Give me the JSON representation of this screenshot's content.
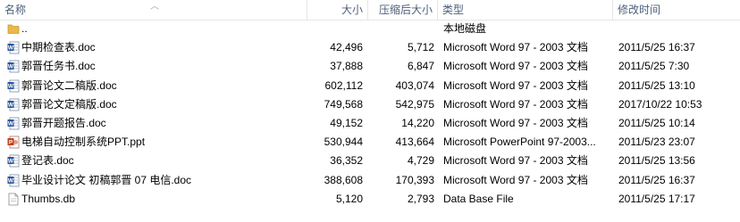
{
  "columns": {
    "name": "名称",
    "size": "大小",
    "compressed": "压缩后大小",
    "type": "类型",
    "modified": "修改时间"
  },
  "files": [
    {
      "name": "..",
      "size": "",
      "compressed": "",
      "type": "本地磁盘",
      "modified": "",
      "icon": "folder-icon"
    },
    {
      "name": "中期检查表.doc",
      "size": "42,496",
      "compressed": "5,712",
      "type": "Microsoft Word 97 - 2003 文档",
      "modified": "2011/5/25 16:37",
      "icon": "word-doc-icon"
    },
    {
      "name": "郭晋任务书.doc",
      "size": "37,888",
      "compressed": "6,847",
      "type": "Microsoft Word 97 - 2003 文档",
      "modified": "2011/5/25 7:30",
      "icon": "word-doc-icon"
    },
    {
      "name": "郭晋论文二稿版.doc",
      "size": "602,112",
      "compressed": "403,074",
      "type": "Microsoft Word 97 - 2003 文档",
      "modified": "2011/5/25 13:10",
      "icon": "word-doc-icon"
    },
    {
      "name": "郭晋论文定稿版.doc",
      "size": "749,568",
      "compressed": "542,975",
      "type": "Microsoft Word 97 - 2003 文档",
      "modified": "2017/10/22 10:53",
      "icon": "word-doc-icon"
    },
    {
      "name": "郭晋开题报告.doc",
      "size": "49,152",
      "compressed": "14,220",
      "type": "Microsoft Word 97 - 2003 文档",
      "modified": "2011/5/25 10:14",
      "icon": "word-doc-icon"
    },
    {
      "name": "电梯自动控制系统PPT.ppt",
      "size": "530,944",
      "compressed": "413,664",
      "type": "Microsoft PowerPoint 97-2003...",
      "modified": "2011/5/23 23:07",
      "icon": "powerpoint-icon"
    },
    {
      "name": "登记表.doc",
      "size": "36,352",
      "compressed": "4,729",
      "type": "Microsoft Word 97 - 2003 文档",
      "modified": "2011/5/25 13:56",
      "icon": "word-doc-icon"
    },
    {
      "name": "毕业设计论文 初稿郭晋 07 电信.doc",
      "size": "388,608",
      "compressed": "170,393",
      "type": "Microsoft Word 97 - 2003 文档",
      "modified": "2011/5/25 16:37",
      "icon": "word-doc-icon"
    },
    {
      "name": "Thumbs.db",
      "size": "5,120",
      "compressed": "2,793",
      "type": "Data Base File",
      "modified": "2011/5/25 17:17",
      "icon": "generic-file-icon"
    }
  ]
}
